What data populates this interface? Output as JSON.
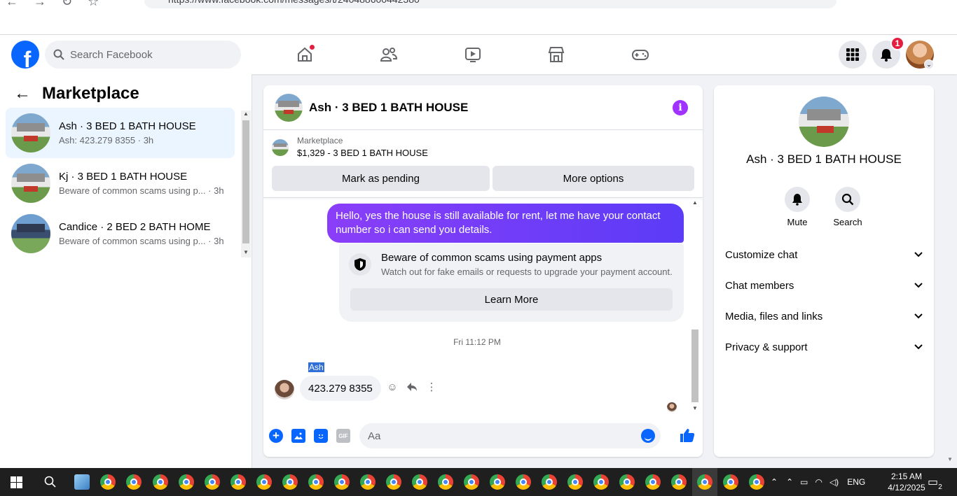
{
  "browser": {
    "url": "https://www.facebook.com/messages/t/240488600442380"
  },
  "topnav": {
    "logo": "f",
    "search_placeholder": "Search Facebook",
    "notification_count": "1"
  },
  "left": {
    "back": "←",
    "title": "Marketplace",
    "conversations": [
      {
        "name": "Ash · 3 BED 1 BATH HOUSE",
        "preview": "Ash: 423.279 8355 · 3h",
        "active": true
      },
      {
        "name": "Kj · 3 BED 1 BATH HOUSE",
        "preview": "Beware of common scams using p... · 3h"
      },
      {
        "name": "Candice · 2 BED 2 BATH HOME",
        "preview": "Beware of common scams using p... · 3h"
      }
    ]
  },
  "chat": {
    "title": "Ash · 3 BED 1 BATH HOUSE",
    "info_glyph": "i",
    "listing_label": "Marketplace",
    "listing_price": "$1,329 - 3 BED 1 BATH HOUSE",
    "mark_pending": "Mark as pending",
    "more_options": "More options",
    "outgoing_message": "Hello, yes the house is still available for rent, let me have your contact number so i can send you details.",
    "warning_title": "Beware of common scams using payment apps",
    "warning_sub": "Watch out for fake emails or requests to upgrade your payment account.",
    "learn_more": "Learn More",
    "timestamp": "Fri 11:12 PM",
    "sender": "Ash",
    "incoming_message": "423.279 8355",
    "composer_placeholder": "Aa",
    "gif_label": "GIF"
  },
  "right": {
    "name": "Ash · 3 BED 1 BATH HOUSE",
    "mute": "Mute",
    "search": "Search",
    "sections": [
      "Customize chat",
      "Chat members",
      "Media, files and links",
      "Privacy & support"
    ]
  },
  "taskbar": {
    "lang": "ENG",
    "time": "2:15 AM",
    "date": "4/12/2025",
    "notif_count": "2"
  },
  "colors": {
    "brand": "#0866ff",
    "outgoing_bubble": "#6a2cf6",
    "info": "#a033ff",
    "badge": "#e41e3f"
  }
}
